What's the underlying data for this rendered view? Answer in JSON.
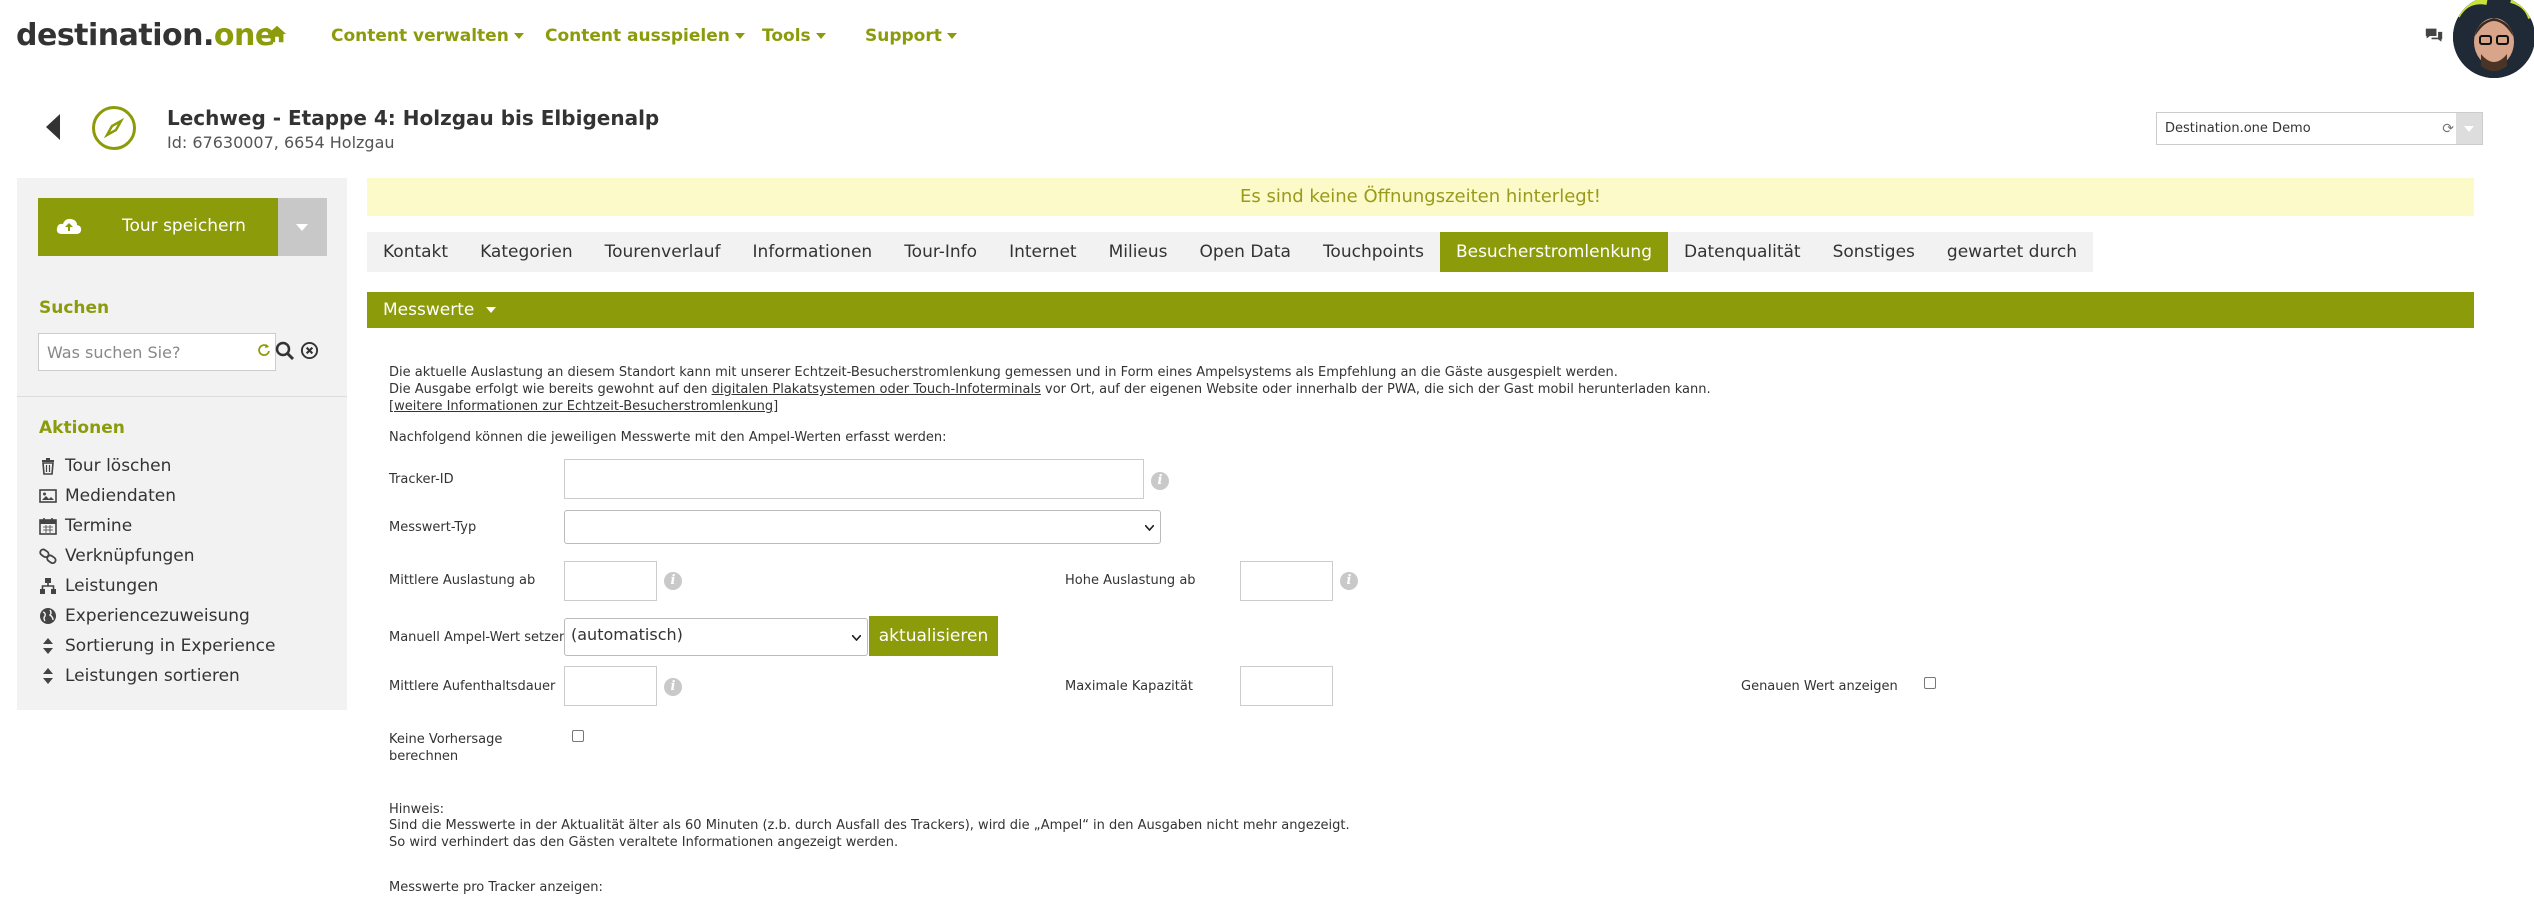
{
  "brand": {
    "logo_main": "destination.",
    "logo_accent": "one",
    "accent_color": "#8c9b0a"
  },
  "nav": {
    "items": [
      {
        "label": "Content verwalten"
      },
      {
        "label": "Content ausspielen"
      },
      {
        "label": "Tools"
      },
      {
        "label": "Support"
      }
    ]
  },
  "header": {
    "title": "Lechweg - Etappe 4: Holzgau bis Elbigenalp",
    "subtitle": "Id: 67630007, 6654 Holzgau",
    "tenant": "Destination.one Demo"
  },
  "sidebar": {
    "save_label": "Tour speichern",
    "search_heading": "Suchen",
    "search_placeholder": "Was suchen Sie?",
    "actions_heading": "Aktionen",
    "actions": [
      {
        "label": "Tour löschen",
        "icon": "trash-icon"
      },
      {
        "label": "Mediendaten",
        "icon": "image-icon"
      },
      {
        "label": "Termine",
        "icon": "calendar-icon"
      },
      {
        "label": "Verknüpfungen",
        "icon": "link-icon"
      },
      {
        "label": "Leistungen",
        "icon": "sitemap-icon"
      },
      {
        "label": "Experiencezuweisung",
        "icon": "globe-icon"
      },
      {
        "label": "Sortierung in Experience",
        "icon": "sort-icon"
      },
      {
        "label": "Leistungen sortieren",
        "icon": "sort-icon"
      }
    ]
  },
  "main": {
    "notice": "Es sind keine Öffnungszeiten hinterlegt!",
    "tabs": [
      {
        "label": "Kontakt"
      },
      {
        "label": "Kategorien"
      },
      {
        "label": "Tourenverlauf"
      },
      {
        "label": "Informationen"
      },
      {
        "label": "Tour-Info"
      },
      {
        "label": "Internet"
      },
      {
        "label": "Milieus"
      },
      {
        "label": "Open Data"
      },
      {
        "label": "Touchpoints"
      },
      {
        "label": "Besucherstromlenkung"
      },
      {
        "label": "Datenqualität"
      },
      {
        "label": "Sonstiges"
      },
      {
        "label": "gewartet durch"
      }
    ],
    "active_tab": "Besucherstromlenkung",
    "panel_title": "Messwerte",
    "intro_line1": "Die aktuelle Auslastung an diesem Standort kann mit unserer Echtzeit-Besucherstromlenkung gemessen und in Form eines Ampelsystems als Empfehlung an die Gäste ausgespielt werden.",
    "intro_line2_pre": "Die Ausgabe erfolgt wie bereits gewohnt auf den ",
    "intro_line2_link": "digitalen Plakatsystemen oder Touch-Infoterminals",
    "intro_line2_post": " vor Ort, auf der eigenen Website oder innerhalb der PWA, die sich der Gast mobil herunterladen kann.",
    "more_info_link": "[weitere Informationen zur Echtzeit-Besucherstromlenkung]",
    "measure_intro": "Nachfolgend können die jeweiligen Messwerte mit den Ampel-Werten erfasst werden:",
    "labels": {
      "tracker_id": "Tracker-ID",
      "messwert_typ": "Messwert-Typ",
      "mittlere_auslastung": "Mittlere Auslastung ab",
      "hohe_auslastung": "Hohe Auslastung ab",
      "manuell_ampel": "Manuell Ampel-Wert setzen",
      "mittlere_aufenthalt": "Mittlere Aufenthaltsdauer",
      "max_kapazitaet": "Maximale Kapazität",
      "genauen_wert": "Genauen Wert anzeigen",
      "keine_vorhersage_1": "Keine Vorhersage",
      "keine_vorhersage_2": "berechnen"
    },
    "ampel_selected": "(automatisch)",
    "update_button": "aktualisieren",
    "hint_title": "Hinweis:",
    "hint_line1": "Sind die Messwerte in der Aktualität älter als 60 Minuten (z.b. durch Ausfall des Trackers), wird die „Ampel“ in den Ausgaben nicht mehr angezeigt.",
    "hint_line2": "So wird verhindert das den Gästen veraltete Informationen angezeigt werden.",
    "per_tracker": "Messwerte pro Tracker anzeigen:"
  }
}
